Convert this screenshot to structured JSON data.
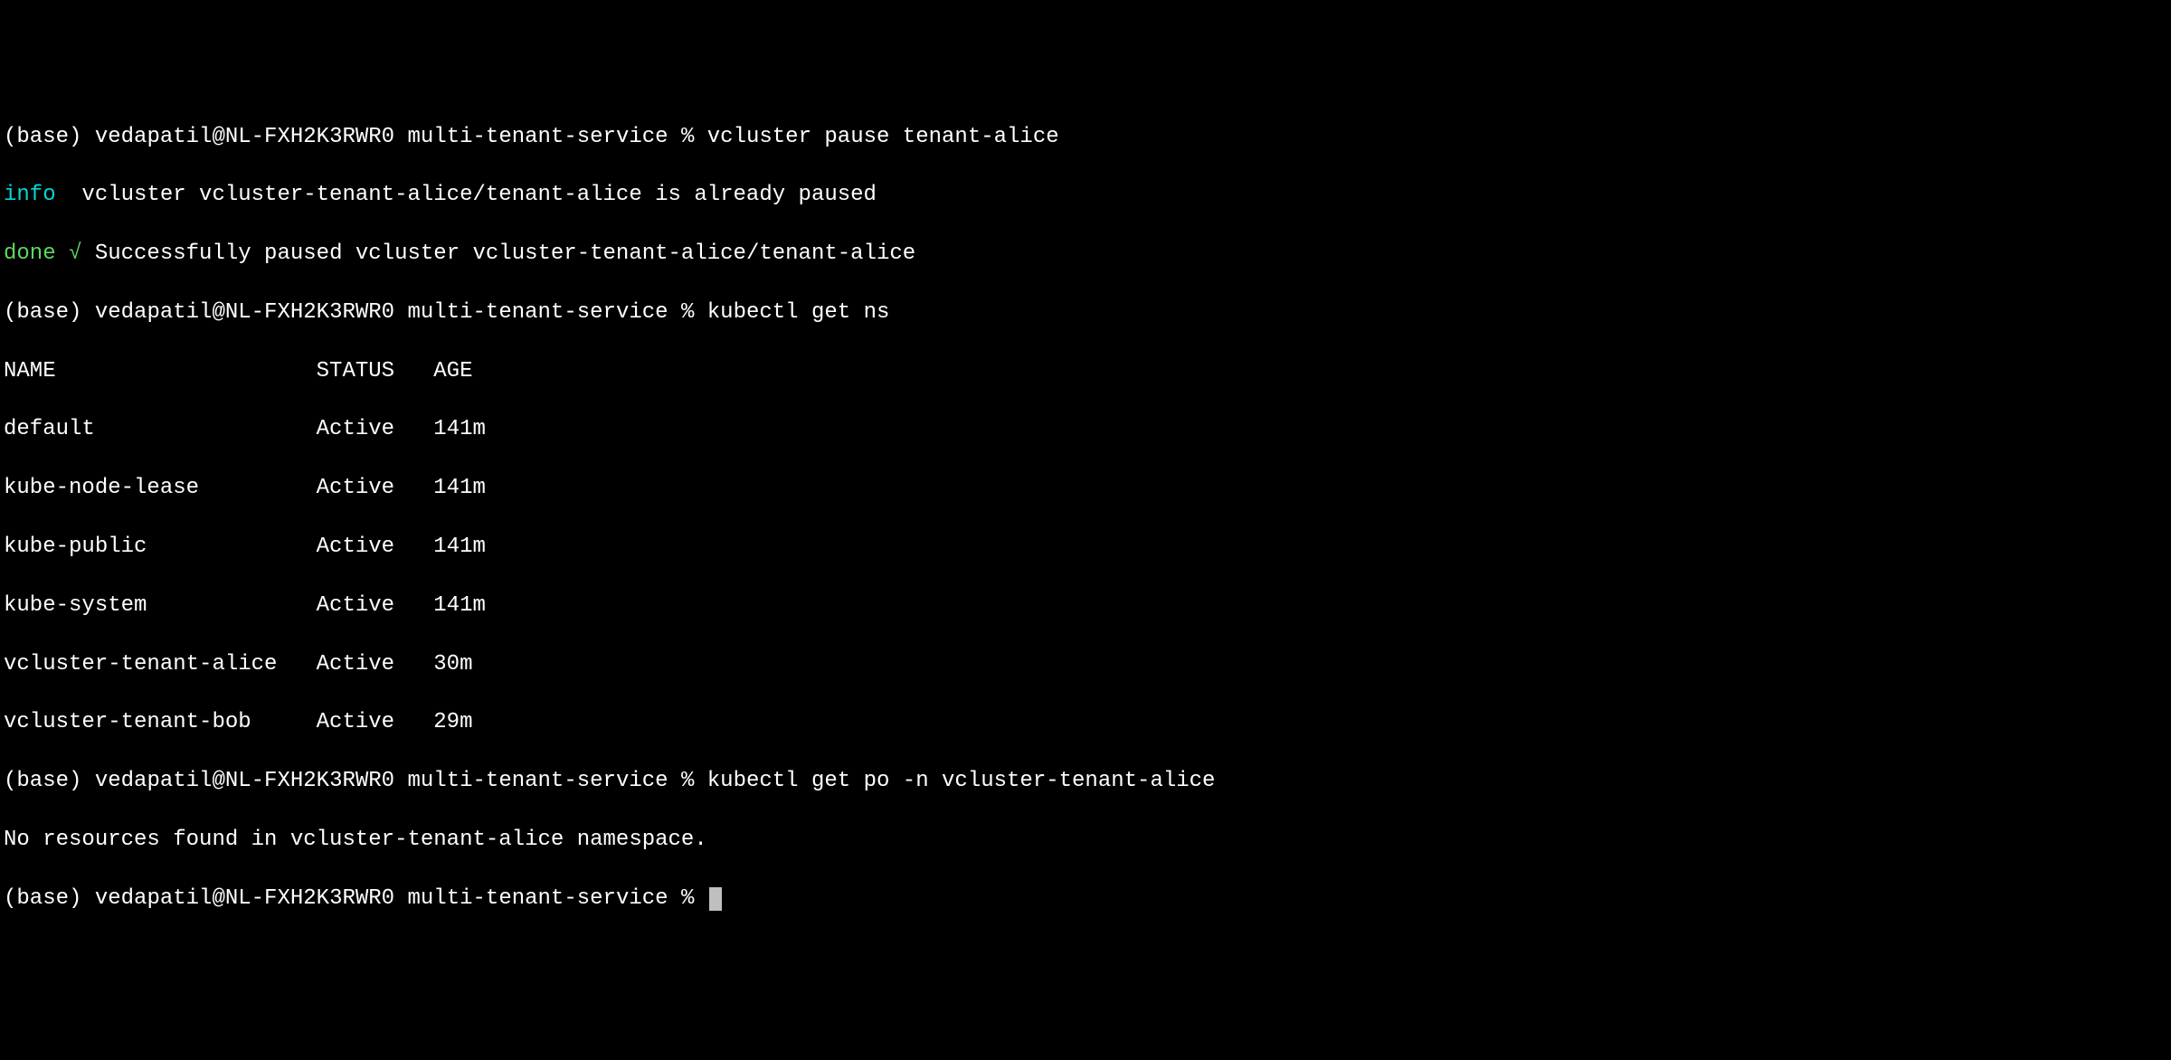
{
  "prompt": {
    "env": "(base)",
    "user_host": "vedapatil@NL-FXH2K3RWR0",
    "dir": "multi-tenant-service",
    "sep": "%"
  },
  "lines": {
    "cmd1": "vcluster pause tenant-alice",
    "info_tag": "info",
    "info_msg": "  vcluster vcluster-tenant-alice/tenant-alice is already paused",
    "done_tag": "done √",
    "done_msg": " Successfully paused vcluster vcluster-tenant-alice/tenant-alice",
    "cmd2": "kubectl get ns",
    "ns_header": "NAME                    STATUS   AGE",
    "ns_rows": [
      "default                 Active   141m",
      "kube-node-lease         Active   141m",
      "kube-public             Active   141m",
      "kube-system             Active   141m",
      "vcluster-tenant-alice   Active   30m",
      "vcluster-tenant-bob     Active   29m"
    ],
    "cmd3": "kubectl get po -n vcluster-tenant-alice",
    "no_resources": "No resources found in vcluster-tenant-alice namespace.",
    "cmd4": ""
  },
  "chart_data": {
    "type": "table",
    "title": "kubectl get ns",
    "columns": [
      "NAME",
      "STATUS",
      "AGE"
    ],
    "rows": [
      {
        "NAME": "default",
        "STATUS": "Active",
        "AGE": "141m"
      },
      {
        "NAME": "kube-node-lease",
        "STATUS": "Active",
        "AGE": "141m"
      },
      {
        "NAME": "kube-public",
        "STATUS": "Active",
        "AGE": "141m"
      },
      {
        "NAME": "kube-system",
        "STATUS": "Active",
        "AGE": "141m"
      },
      {
        "NAME": "vcluster-tenant-alice",
        "STATUS": "Active",
        "AGE": "30m"
      },
      {
        "NAME": "vcluster-tenant-bob",
        "STATUS": "Active",
        "AGE": "29m"
      }
    ]
  }
}
